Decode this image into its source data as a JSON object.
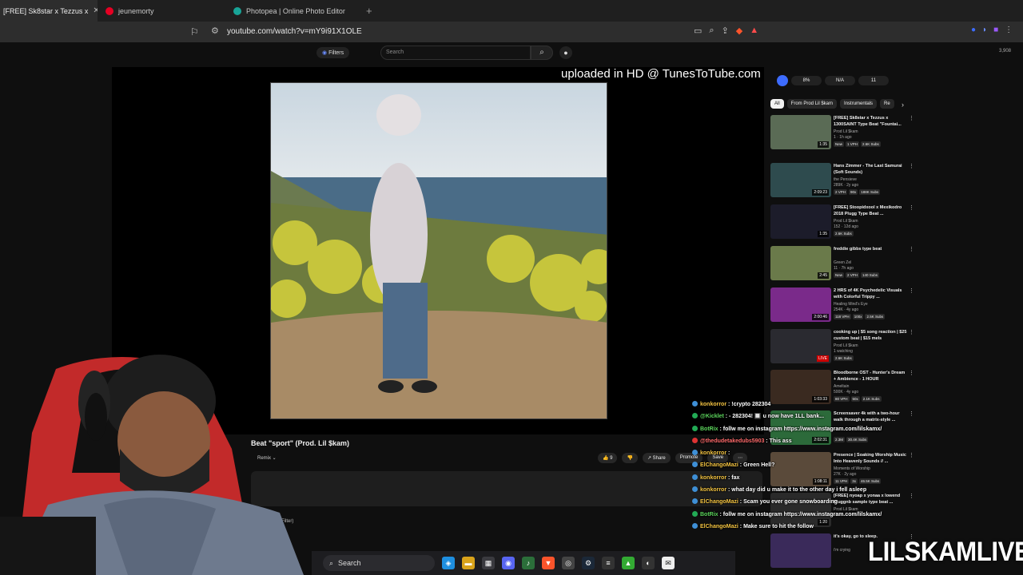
{
  "browser": {
    "tabs": [
      {
        "label": "[FREE] Sk8star x Tezzus x",
        "active": true
      },
      {
        "label": "jeunemorty",
        "active": false
      },
      {
        "label": "Photopea | Online Photo Editor",
        "active": false
      }
    ],
    "url": "youtube.com/watch?v=mY9i91X1OLE"
  },
  "yt_header": {
    "filters_label": "Filters",
    "search_placeholder": "Search",
    "count": "3,908"
  },
  "player": {
    "watermark": "uploaded in HD @ TunesToTube.com"
  },
  "video": {
    "title": "Beat \"sport\" (Prod. Lil $kam)",
    "remix_label": "Remix",
    "like_count": "9",
    "share_label": "Share",
    "promote_label": "Promote",
    "save_label": "Save",
    "filter_label": "Filter)"
  },
  "sidebar": {
    "stats": [
      "8%",
      "N/A",
      "11"
    ],
    "chips": [
      "All",
      "From Prod Lil $kam",
      "Instrumentals",
      "Re"
    ],
    "recs": [
      {
        "title": "[FREE] Sk8star x Tezzus x 1300SAINT Type Beat \"Fountai...",
        "channel": "Prod Lil $kam",
        "meta": "1 · 1h ago",
        "duration": "1:35",
        "badges": [
          "New",
          "1 VPH",
          "2.6K Subs"
        ]
      },
      {
        "title": "Hans Zimmer - The Last Samurai (Soft Sounds)",
        "channel": "the Pensieve",
        "meta": "289K · 2y ago",
        "duration": "2:09:23",
        "badges": [
          "2 VPH",
          "90x",
          "188K Subs"
        ]
      },
      {
        "title": "[FREE] Stoopidxool x Mexikodro 2018 Plugg Type Beat ...",
        "channel": "Prod Lil $kam",
        "meta": "152 · 12d ago",
        "duration": "1:35",
        "badges": [
          "2.6K Subs"
        ]
      },
      {
        "title": "freddie gibbs type beat",
        "channel": "Green Zel",
        "meta": "11 · 7h ago",
        "duration": "2:45",
        "badges": [
          "New",
          "2 VPH",
          "140 Subs"
        ]
      },
      {
        "title": "2 HRS of 4K Psychedelic Visuals with Colorful Trippy ...",
        "channel": "Healing Mind's Eye",
        "meta": "254K · 4y ago",
        "duration": "2:00:46",
        "badges": [
          "118 VPH",
          "100x",
          "2.5K Subs"
        ]
      },
      {
        "title": "cooking up | $5 song reaction | $25 custom beat | $15 mels",
        "channel": "Prod Lil $kam",
        "meta": "1 watching",
        "duration": "LIVE",
        "badges": [
          "2.6K Subs"
        ]
      },
      {
        "title": "Bloodborne OST - Hunter's Dream + Ambience - 1 HOUR",
        "channel": "Ameltain",
        "meta": "500K · 4y ago",
        "duration": "1:03:33",
        "badges": [
          "80 VPH",
          "50x",
          "2.1K Subs"
        ]
      },
      {
        "title": "Screensaver 4k with a two-hour walk through a matrix-style ...",
        "channel": "",
        "meta": "",
        "duration": "2:02:31",
        "badges": [
          "2.3M",
          "30.4K Subs"
        ]
      },
      {
        "title": "Presence | Soaking Worship Music Into Heavenly Sounds // ...",
        "channel": "Moments of Worship",
        "meta": "27K · 2y ago",
        "duration": "1:08:11",
        "badges": [
          "11 VPH",
          "3x",
          "46.5K Subs"
        ]
      },
      {
        "title": "[FREE] nyoap x yonaa x lowend Pluggnb sample type beat ...",
        "channel": "Prod Lil $kam",
        "meta": "",
        "duration": "1:20",
        "badges": []
      },
      {
        "title": "it's okay, go to sleep.",
        "channel": "i'm crying",
        "meta": "",
        "duration": "",
        "badges": []
      }
    ]
  },
  "chat": [
    {
      "user": "konkorror",
      "text": ": !crypto 282304",
      "color": "y"
    },
    {
      "user": "@Kicklet",
      "text": ": - 282304! 🔲 u now have 1LL bank...",
      "color": "g"
    },
    {
      "user": "BotRix",
      "text": ": follw me on instagram https://www.instagram.com/lilskamx/",
      "color": "g"
    },
    {
      "user": "@thedudetakedubs5903",
      "text": ": This ass",
      "color": "r"
    },
    {
      "user": "konkorror",
      "text": ":",
      "color": "y"
    },
    {
      "user": "ElChangoMazi",
      "text": ": Green Hell?",
      "color": "y"
    },
    {
      "user": "konkorror",
      "text": ": fax",
      "color": "y"
    },
    {
      "user": "konkorror",
      "text": ": what day did u make it to the other day i fell asleep",
      "color": "y"
    },
    {
      "user": "ElChangoMazi",
      "text": ": Scam you ever gone snowboarding",
      "color": "y"
    },
    {
      "user": "BotRix",
      "text": ": follw me on instagram https://www.instagram.com/lilskamx/",
      "color": "g"
    },
    {
      "user": "ElChangoMazi",
      "text": ": Make sure to hit the follow",
      "color": "y"
    }
  ],
  "taskbar": {
    "search_label": "Search"
  },
  "overlay": {
    "brand": "LILSKAMLIVE"
  },
  "colors": {
    "bg": "#0f0f0f",
    "accent": "#3d6cff",
    "live_red": "#cc0000"
  }
}
